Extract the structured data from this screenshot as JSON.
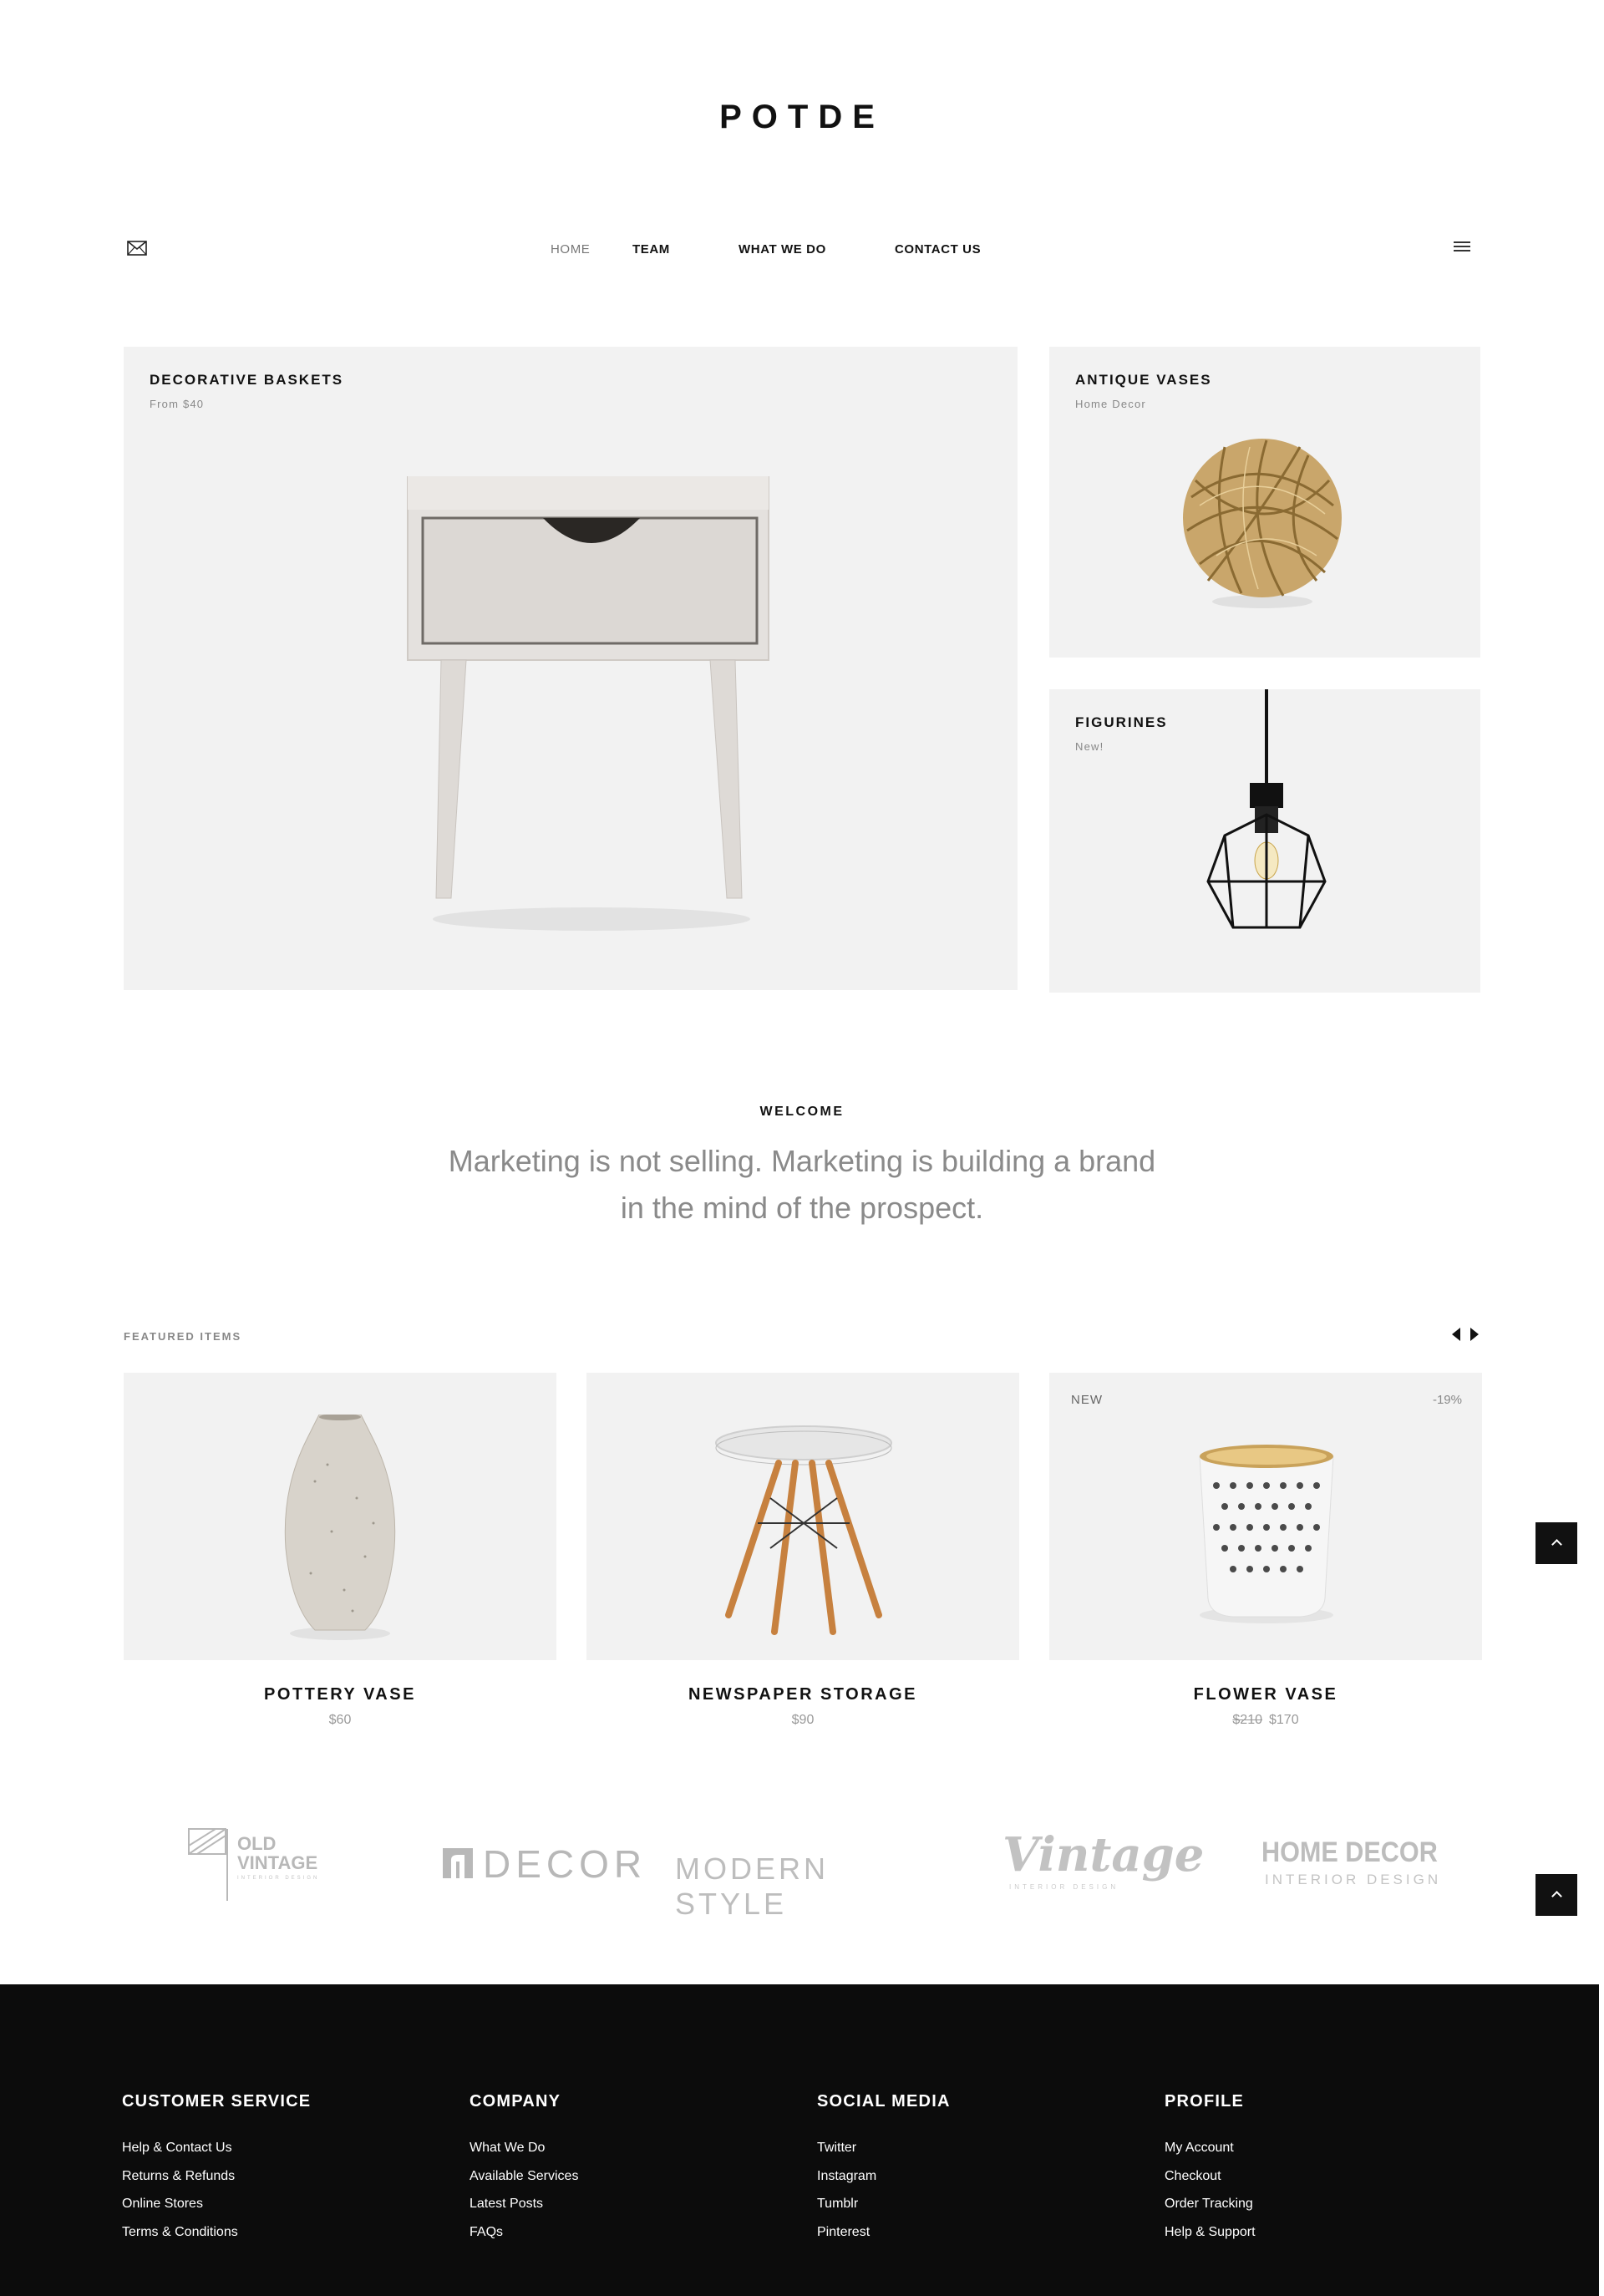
{
  "brand": {
    "logo": "POTDE"
  },
  "nav": {
    "home": "HOME",
    "team": "TEAM",
    "what_we_do": "WHAT WE DO",
    "contact_us": "CONTACT US"
  },
  "hero": {
    "main": {
      "title": "DECORATIVE BASKETS",
      "subtitle": "From $40"
    },
    "top_right": {
      "title": "ANTIQUE VASES",
      "subtitle": "Home Decor"
    },
    "bottom_right": {
      "title": "FIGURINES",
      "subtitle": "New!"
    }
  },
  "welcome": {
    "label": "WELCOME",
    "quote_line1": "Marketing is not selling. Marketing is building a brand",
    "quote_line2": "in the mind of the prospect."
  },
  "featured": {
    "label": "FEATURED ITEMS",
    "items": [
      {
        "name": "POTTERY VASE",
        "price": "$60"
      },
      {
        "name": "NEWSPAPER STORAGE",
        "price": "$90"
      },
      {
        "name": "FLOWER VASE",
        "old_price": "$210",
        "price": "$170",
        "badge_new": "NEW",
        "badge_sale": "-19%"
      }
    ]
  },
  "brands": {
    "old_vintage": {
      "line1": "OLD",
      "line2": "VINTAGE",
      "tag": "INTERIOR DESIGN"
    },
    "decor": "DECOR",
    "modern_style": "MODERN STYLE",
    "vintage": {
      "word": "Vintage",
      "tag": "INTERIOR DESIGN"
    },
    "home_decor": {
      "word": "HOME DECOR",
      "tag": "INTERIOR DESIGN"
    }
  },
  "footer": {
    "columns": [
      {
        "title": "CUSTOMER SERVICE",
        "links": [
          "Help & Contact Us",
          "Returns & Refunds",
          "Online Stores",
          "Terms & Conditions"
        ]
      },
      {
        "title": "COMPANY",
        "links": [
          "What We Do",
          "Available Services",
          "Latest Posts",
          "FAQs"
        ]
      },
      {
        "title": "SOCIAL MEDIA",
        "links": [
          "Twitter",
          "Instagram",
          "Tumblr",
          "Pinterest"
        ]
      },
      {
        "title": "PROFILE",
        "links": [
          "My Account",
          "Checkout",
          "Order Tracking",
          "Help & Support"
        ]
      }
    ]
  },
  "colors": {
    "panel_bg": "#f2f2f2",
    "footer_bg": "#0c0c0c",
    "accent": "#111111",
    "muted": "#8a8a8a"
  },
  "icons": {
    "mail": "mail-icon",
    "menu": "hamburger-menu-icon",
    "scroll_top": "chevron-up-icon",
    "prev": "arrow-left-icon",
    "next": "arrow-right-icon"
  }
}
